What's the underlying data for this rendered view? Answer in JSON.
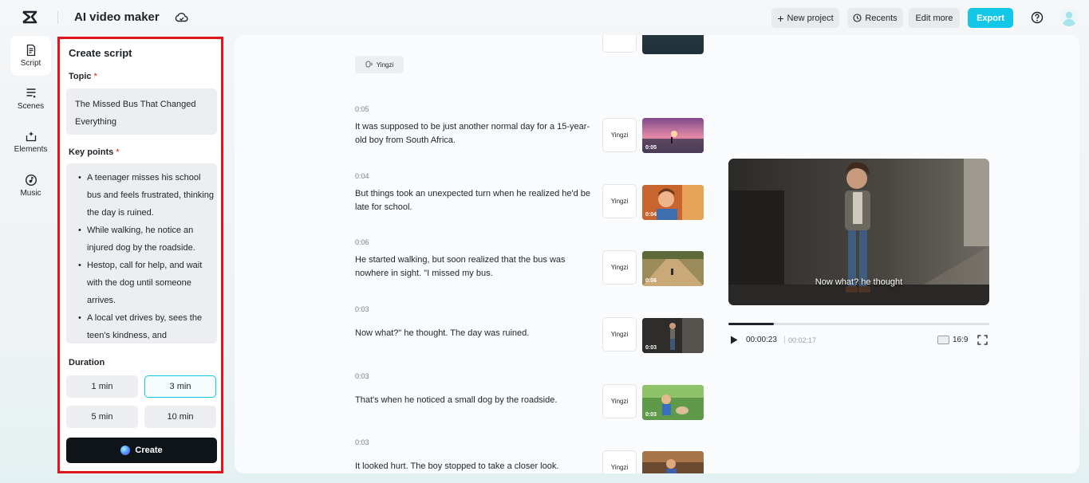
{
  "app": {
    "title": "AI video maker"
  },
  "topbar": {
    "new_project": "New project",
    "recents": "Recents",
    "edit_more": "Edit more",
    "export": "Export"
  },
  "nav": [
    {
      "label": "Script",
      "icon": "script-icon"
    },
    {
      "label": "Scenes",
      "icon": "scenes-icon"
    },
    {
      "label": "Elements",
      "icon": "elements-icon"
    },
    {
      "label": "Music",
      "icon": "music-icon"
    }
  ],
  "panel": {
    "title": "Create script",
    "topic_label": "Topic",
    "required_mark": "*",
    "topic_value_line1": "The Missed Bus That Changed",
    "topic_value_line2": "Everything",
    "keypoints_label": "Key points",
    "keypoints": [
      "A teenager misses his school bus and feels frustrated, thinking the day is ruined.",
      "While walking, he notice an injured dog by the roadside.",
      "Hestop, call for help, and wait with the dog until someone arrives.",
      "A local vet drives by, sees the teen's kindness, and"
    ],
    "duration_label": "Duration",
    "durations": [
      "1 min",
      "3 min",
      "5 min",
      "10 min"
    ],
    "selected_duration": "3 min",
    "create_label": "Create"
  },
  "script": {
    "voice_chip": "Yingzi",
    "scenes": [
      {
        "time": "0:05",
        "text": "It was supposed to be just another normal day for a 15-year-old boy from South Africa.",
        "voice": "Yingzi",
        "thumb_label": "0:05"
      },
      {
        "time": "0:04",
        "text": "But things took an unexpected turn when he realized he'd be late for school.",
        "voice": "Yingzi",
        "thumb_label": "0:04"
      },
      {
        "time": "0:06",
        "text": "He started walking, but soon realized that the bus was nowhere in sight. \"I missed my bus.",
        "voice": "Yingzi",
        "thumb_label": "0:06"
      },
      {
        "time": "0:03",
        "text": "Now what?\" he thought. The day was ruined.",
        "voice": "Yingzi",
        "thumb_label": "0:03"
      },
      {
        "time": "0:03",
        "text": "That's when he noticed a small dog by the roadside.",
        "voice": "Yingzi",
        "thumb_label": "0:03"
      },
      {
        "time": "0:03",
        "text": "It looked hurt. The boy stopped to take a closer look.",
        "voice": "Yingzi",
        "thumb_label": ""
      }
    ]
  },
  "preview": {
    "caption": "Now what?  he thought",
    "current_time": "00:00:23",
    "separator": "|",
    "total_time": "00:02:17",
    "progress_fraction": 0.175,
    "aspect_ratio": "16:9"
  },
  "colors": {
    "accent": "#14c7e6",
    "highlight_border": "#e0161c",
    "dark_button": "#0f1419"
  }
}
